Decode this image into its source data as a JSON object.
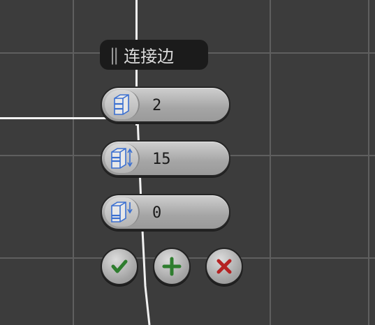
{
  "caddy": {
    "title": "连接边",
    "grip": "||",
    "fields": [
      {
        "name": "segments",
        "value": "2",
        "icon": "segments-icon"
      },
      {
        "name": "pinch",
        "value": "15",
        "icon": "pinch-icon"
      },
      {
        "name": "slide",
        "value": "0",
        "icon": "slide-icon"
      }
    ],
    "buttons": [
      {
        "name": "ok",
        "icon": "check-icon",
        "color": "#2e7d2e"
      },
      {
        "name": "apply",
        "icon": "plus-icon",
        "color": "#2e7d2e"
      },
      {
        "name": "cancel",
        "icon": "close-icon",
        "color": "#b52222"
      }
    ]
  },
  "colors": {
    "viewport_bg": "#3c3c3c",
    "grid": "#5f5f5f",
    "selected_edge": "#f2f2f2",
    "icon_blue": "#3a6fd1"
  }
}
